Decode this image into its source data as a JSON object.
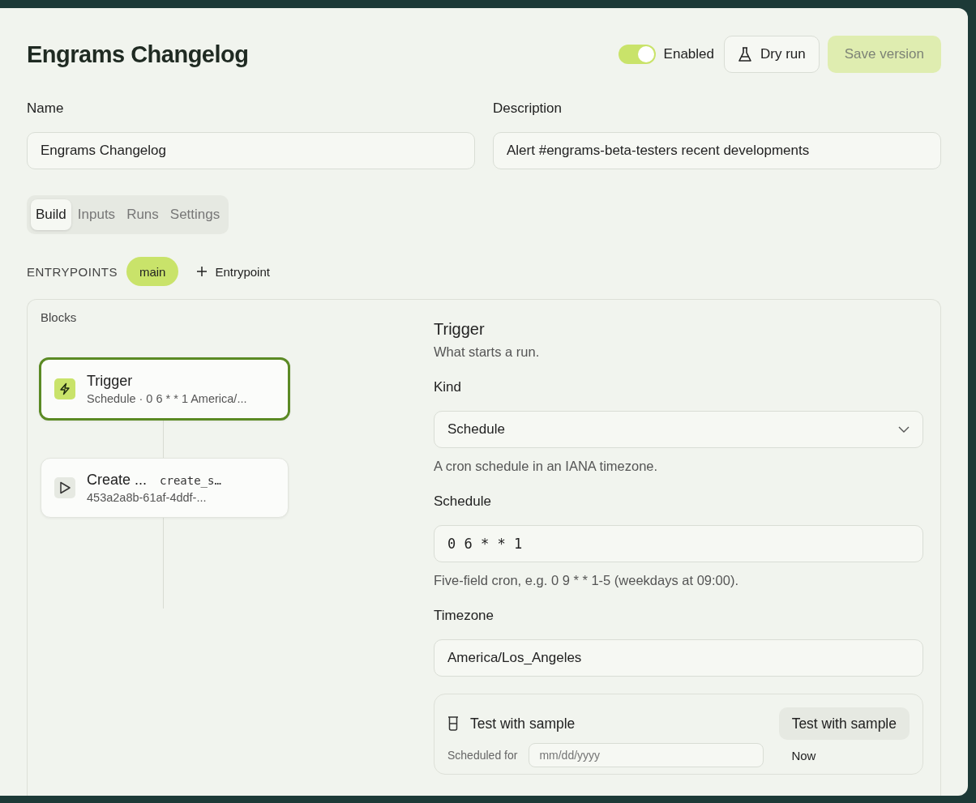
{
  "header": {
    "title": "Engrams Changelog",
    "enabled_label": "Enabled",
    "enabled": true,
    "dry_run": "Dry run",
    "save": "Save version",
    "save_disabled": true
  },
  "fields": [
    {
      "label": "Name",
      "value": "Engrams Changelog"
    },
    {
      "label": "Description",
      "value": "Alert #engrams-beta-testers recent developments"
    }
  ],
  "tabs": [
    {
      "label": "Build",
      "selected": true
    },
    {
      "label": "Inputs",
      "selected": false
    },
    {
      "label": "Runs",
      "selected": false
    },
    {
      "label": "Settings",
      "selected": false
    }
  ],
  "entrypoints": {
    "label": "ENTRYPOINTS",
    "items": [
      {
        "label": "main",
        "selected": true
      }
    ],
    "add": "Entrypoint"
  },
  "blocks": {
    "title": "Blocks",
    "items": [
      {
        "kind": "trigger",
        "title": "Trigger",
        "subtitle": "Schedule · 0 6 * * 1 America/...",
        "selected": true
      },
      {
        "kind": "action",
        "title": "Create ...",
        "code": "create_s…",
        "subtitle": "453a2a8b-61af-4ddf-...",
        "selected": false
      }
    ]
  },
  "detail": {
    "title": "Trigger",
    "subtitle": "What starts a run.",
    "kind": {
      "label": "Kind",
      "value": "Schedule",
      "help": "A cron schedule in an IANA timezone."
    },
    "schedule": {
      "label": "Schedule",
      "value": "0 6 * * 1",
      "help": "Five-field cron, e.g. 0 9 * * 1-5 (weekdays at 09:00)."
    },
    "timezone": {
      "label": "Timezone",
      "value": "America/Los_Angeles"
    },
    "test": {
      "title": "Test with sample",
      "button": "Test with sample",
      "scheduled_label": "Scheduled for",
      "date_placeholder": "mm/dd/yyyy",
      "now": "Now"
    }
  }
}
